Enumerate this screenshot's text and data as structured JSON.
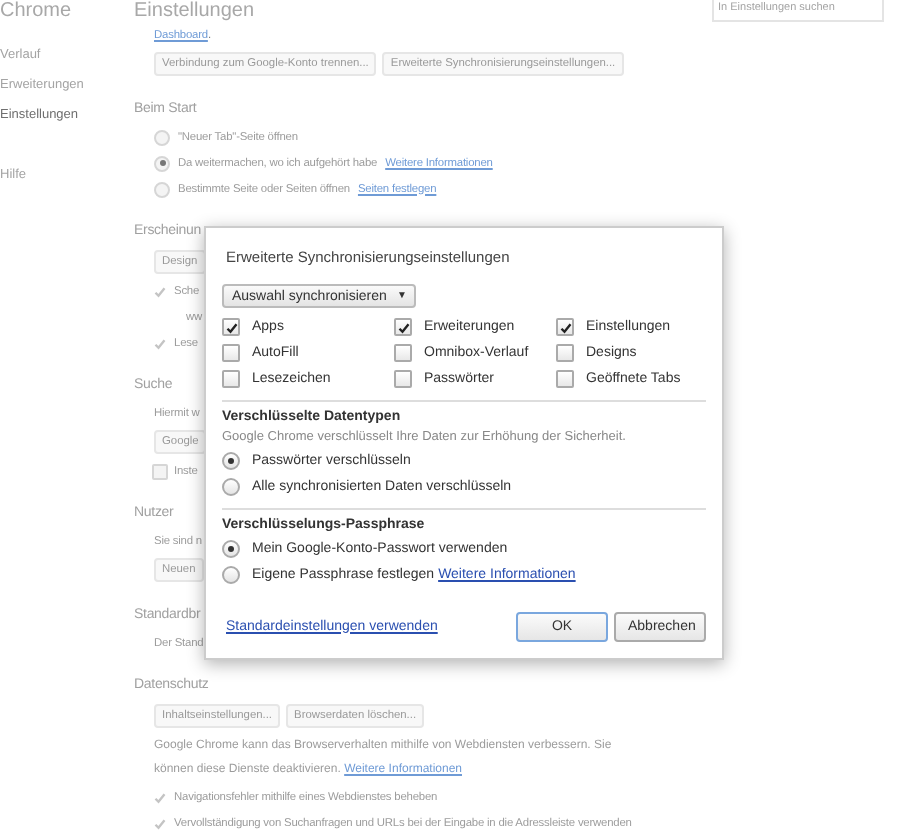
{
  "sidebar": {
    "title": "Chrome",
    "items": [
      {
        "label": "Verlauf",
        "selected": false
      },
      {
        "label": "Erweiterungen",
        "selected": false
      },
      {
        "label": "Einstellungen",
        "selected": true
      },
      {
        "label": "Hilfe",
        "selected": false
      }
    ]
  },
  "header": {
    "title": "Einstellungen",
    "search": {
      "placeholder": "In Einstellungen suchen"
    }
  },
  "sections": [
    {
      "items": [
        {
          "kind": "text",
          "link": "Dashboard",
          "tail": "."
        },
        {
          "kind": "buttons",
          "buttons": [
            "Verbindung zum Google-Konto trennen...",
            "Erweiterte Synchronisierungseinstellungen..."
          ]
        }
      ]
    },
    {
      "title": "Beim Start",
      "items": [
        {
          "kind": "radio",
          "selected": false,
          "text": "\"Neuer Tab\"-Seite öffnen"
        },
        {
          "kind": "radio",
          "selected": true,
          "text": "Da weitermachen, wo ich aufgehört habe",
          "link": "Weitere Informationen"
        },
        {
          "kind": "radio",
          "selected": false,
          "text": "Bestimmte Seite oder Seiten öffnen",
          "link": "Seiten festlegen"
        }
      ]
    },
    {
      "title": "Erscheinun",
      "items": [
        {
          "kind": "buttons",
          "buttons": [
            "Design"
          ]
        },
        {
          "kind": "check",
          "checked": true,
          "text": "Sche"
        },
        {
          "kind": "note",
          "text": "ww"
        },
        {
          "kind": "check",
          "checked": true,
          "text": "Lese"
        }
      ]
    },
    {
      "title": "Suche",
      "items": [
        {
          "kind": "text",
          "text": "Hiermit w"
        },
        {
          "kind": "buttons",
          "buttons": [
            "Google"
          ]
        },
        {
          "kind": "check",
          "checked": false,
          "text": "Inste"
        }
      ]
    },
    {
      "title": "Nutzer",
      "items": [
        {
          "kind": "text",
          "text": "Sie sind n"
        },
        {
          "kind": "buttons",
          "buttons": [
            "Neuen"
          ]
        }
      ]
    },
    {
      "title": "Standardbr",
      "items": [
        {
          "kind": "text",
          "text": "Der Stand"
        }
      ]
    },
    {
      "title": "Datenschutz",
      "items": [
        {
          "kind": "buttons",
          "buttons": [
            "Inhaltseinstellungen...",
            "Browserdaten löschen..."
          ]
        },
        {
          "kind": "text",
          "text": "Google Chrome kann das Browserverhalten mithilfe von Webdiensten verbessern. Sie können diese Dienste deaktivieren.",
          "link": "Weitere Informationen"
        },
        {
          "kind": "check",
          "checked": true,
          "text": "Navigationsfehler mithilfe eines Webdienstes beheben"
        },
        {
          "kind": "check",
          "checked": true,
          "text": "Vervollständigung von Suchanfragen und URLs bei der Eingabe in die Adressleiste verwenden"
        }
      ]
    }
  ],
  "dialog": {
    "title": "Erweiterte Synchronisierungseinstellungen",
    "dropdown": "Auswahl synchronisieren",
    "caret": "▼",
    "types": [
      {
        "label": "Apps",
        "checked": true
      },
      {
        "label": "Erweiterungen",
        "checked": true
      },
      {
        "label": "Einstellungen",
        "checked": true
      },
      {
        "label": "AutoFill",
        "checked": false
      },
      {
        "label": "Omnibox-Verlauf",
        "checked": false
      },
      {
        "label": "Designs",
        "checked": false
      },
      {
        "label": "Lesezeichen",
        "checked": false
      },
      {
        "label": "Passwörter",
        "checked": false
      },
      {
        "label": "Geöffnete Tabs",
        "checked": false
      }
    ],
    "groups": [
      {
        "title": "Verschlüsselte Datentypen",
        "description": "Google Chrome verschlüsselt Ihre Daten zur Erhöhung der Sicherheit.",
        "options": [
          {
            "text": "Passwörter verschlüsseln",
            "selected": true
          },
          {
            "text": "Alle synchronisierten Daten verschlüsseln",
            "selected": false
          }
        ]
      },
      {
        "title": "Verschlüsselungs-Passphrase",
        "options": [
          {
            "text": "Mein Google-Konto-Passwort verwenden",
            "selected": true
          },
          {
            "text": "Eigene Passphrase festlegen",
            "link": "Weitere Informationen",
            "selected": false
          }
        ]
      }
    ],
    "reset_link": "Standardeinstellungen verwenden",
    "buttons": [
      {
        "label": "OK",
        "kind": "primary"
      },
      {
        "label": "Abbrechen",
        "kind": "secondary"
      }
    ]
  }
}
